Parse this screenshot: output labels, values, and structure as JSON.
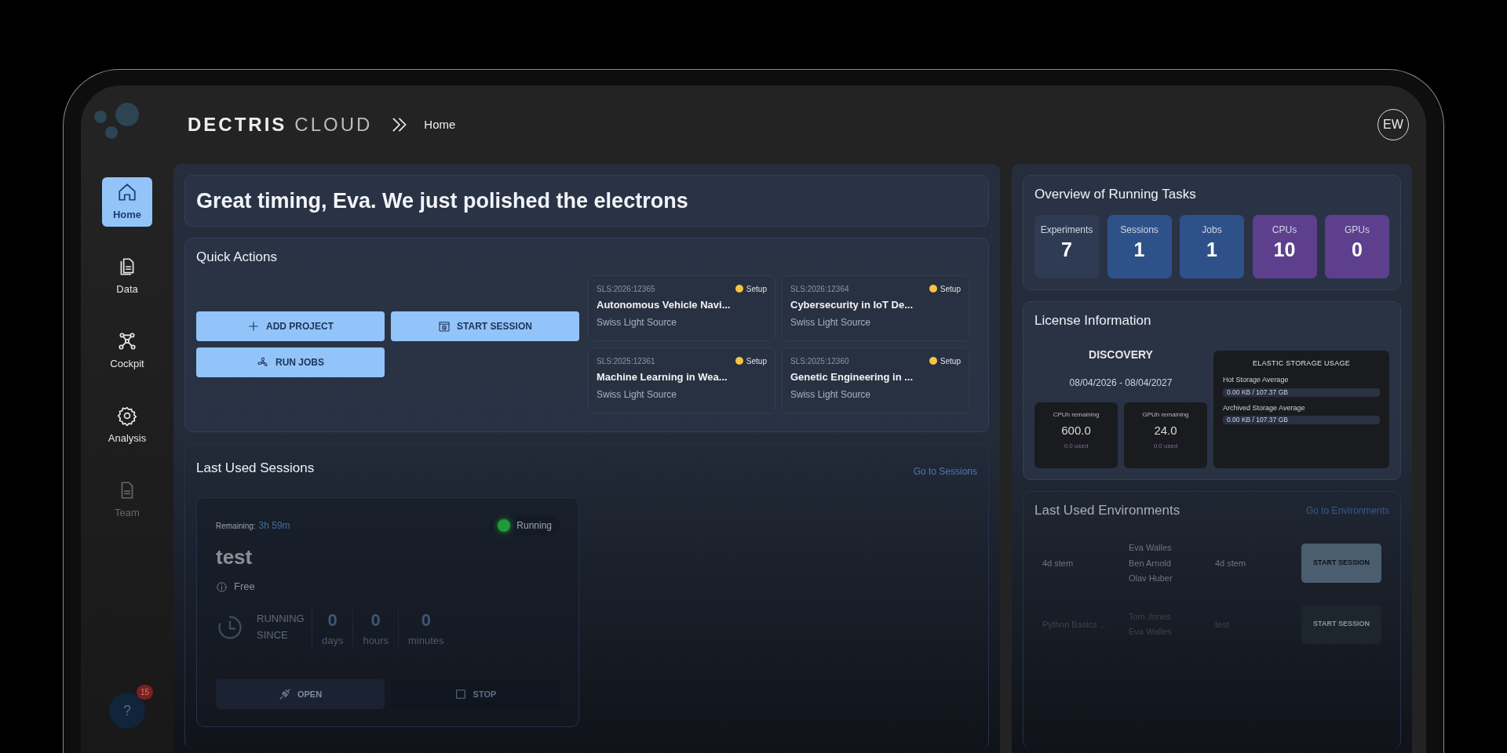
{
  "logo": {
    "brand": "DECTRIS",
    "product": "CLOUD"
  },
  "breadcrumb": "Home",
  "user": {
    "initials": "EW"
  },
  "sidebar": {
    "items": [
      {
        "label": "Home",
        "selected": true,
        "disabled": false
      },
      {
        "label": "Data",
        "selected": false,
        "disabled": false
      },
      {
        "label": "Cockpit",
        "selected": false,
        "disabled": false
      },
      {
        "label": "Analysis",
        "selected": false,
        "disabled": false
      },
      {
        "label": "Team",
        "selected": false,
        "disabled": true
      }
    ]
  },
  "help": {
    "label": "?",
    "badge": "15"
  },
  "greeting": "Great timing, Eva. We just polished the electrons",
  "quick_actions": {
    "title": "Quick Actions",
    "buttons": [
      {
        "label": "ADD PROJECT"
      },
      {
        "label": "START SESSION"
      },
      {
        "label": "RUN JOBS"
      }
    ],
    "projects": [
      {
        "id": "SLS:2026:12365",
        "status": "Setup",
        "color": "#f5c542",
        "title": "Autonomous Vehicle Navi...",
        "source": "Swiss Light Source"
      },
      {
        "id": "SLS:2026:12364",
        "status": "Setup",
        "color": "#f5c542",
        "title": "Cybersecurity in IoT De...",
        "source": "Swiss Light Source"
      },
      {
        "id": "SLS:2025:12361",
        "status": "Setup",
        "color": "#f5c542",
        "title": "Machine Learning in Wea...",
        "source": "Swiss Light Source"
      },
      {
        "id": "SLS:2025:12360",
        "status": "Setup",
        "color": "#f5c542",
        "title": "Genetic Engineering in ...",
        "source": "Swiss Light Source"
      }
    ]
  },
  "sessions": {
    "title": "Last Used Sessions",
    "link": "Go to Sessions",
    "card": {
      "remaining_label": "Remaining:",
      "remaining": "3h 59m",
      "status": "Running",
      "name": "test",
      "plan": "Free",
      "since_label": "RUNNING SINCE",
      "counters": [
        {
          "value": "0",
          "unit": "days"
        },
        {
          "value": "0",
          "unit": "hours"
        },
        {
          "value": "0",
          "unit": "minutes"
        }
      ],
      "buttons": [
        {
          "label": "OPEN"
        },
        {
          "label": "STOP"
        }
      ]
    }
  },
  "overview": {
    "title": "Overview of Running Tasks",
    "tiles": [
      {
        "label": "Experiments",
        "value": "7",
        "color": "#2e3b52"
      },
      {
        "label": "Sessions",
        "value": "1",
        "color": "#2f5189"
      },
      {
        "label": "Jobs",
        "value": "1",
        "color": "#2f5189"
      },
      {
        "label": "CPUs",
        "value": "10",
        "color": "#5d3f8d"
      },
      {
        "label": "GPUs",
        "value": "0",
        "color": "#5d3f8d"
      }
    ]
  },
  "license": {
    "title": "License Information",
    "plan": "DISCOVERY",
    "period": "08/04/2026 - 08/04/2027",
    "quotas": [
      {
        "label": "CPUh remaining",
        "value": "600.0",
        "used": "0.0 used"
      },
      {
        "label": "GPUh remaining",
        "value": "24.0",
        "used": "0.0 used"
      }
    ],
    "storage": {
      "title": "ELASTIC STORAGE USAGE",
      "items": [
        {
          "label": "Hot Storage Average",
          "reading": "0.00 KB / 107.37 GB",
          "level": 0
        },
        {
          "label": "Archived Storage Average",
          "reading": "0.00 KB / 107.37 GB",
          "level": 0
        }
      ]
    }
  },
  "environments": {
    "title": "Last Used Environments",
    "link": "Go to Environments",
    "rows": [
      {
        "name": "4d stem",
        "users": [
          "Eva Walles",
          "Ben Arnold",
          "Olav Huber"
        ],
        "column_3": "4d stem",
        "button": "START SESSION"
      },
      {
        "name": "Python Basics ...",
        "users": [
          "Tom Jones",
          "Eva Walles"
        ],
        "column_3": "test",
        "button": "START SESSION"
      }
    ]
  }
}
